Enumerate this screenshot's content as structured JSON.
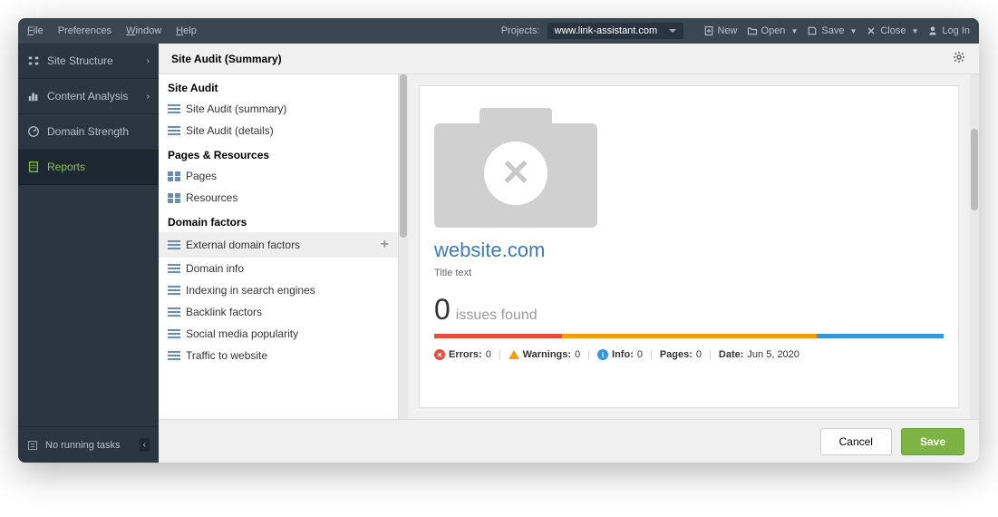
{
  "menubar": {
    "file": "File",
    "preferences": "Preferences",
    "window": "Window",
    "help": "Help",
    "projects_label": "Projects:",
    "project_value": "www.link-assistant.com",
    "new": "New",
    "open": "Open",
    "save": "Save",
    "close": "Close",
    "login": "Log In"
  },
  "sidebar": {
    "items": [
      {
        "label": "Site Structure"
      },
      {
        "label": "Content Analysis"
      },
      {
        "label": "Domain Strength"
      },
      {
        "label": "Reports"
      }
    ],
    "footer": "No running tasks"
  },
  "header": {
    "title": "Site Audit (Summary)"
  },
  "tree": {
    "section1": "Site Audit",
    "section1_items": [
      "Site Audit (summary)",
      "Site Audit (details)"
    ],
    "section2": "Pages & Resources",
    "section2_items": [
      "Pages",
      "Resources"
    ],
    "section3": "Domain factors",
    "section3_items": [
      "External domain factors",
      "Domain info",
      "Indexing in search engines",
      "Backlink factors",
      "Social media popularity",
      "Traffic to website"
    ]
  },
  "preview": {
    "site": "website.com",
    "title_text": "Title text",
    "issues_count": "0",
    "issues_label": "issues found",
    "errors_label": "Errors:",
    "errors_val": "0",
    "warnings_label": "Warnings:",
    "warnings_val": "0",
    "info_label": "Info:",
    "info_val": "0",
    "pages_label": "Pages:",
    "pages_val": "0",
    "date_label": "Date:",
    "date_val": "Jun 5, 2020",
    "colors": [
      "#e74c3c",
      "#f39c12",
      "#f39c12",
      "#3498db"
    ]
  },
  "buttons": {
    "cancel": "Cancel",
    "save": "Save"
  }
}
